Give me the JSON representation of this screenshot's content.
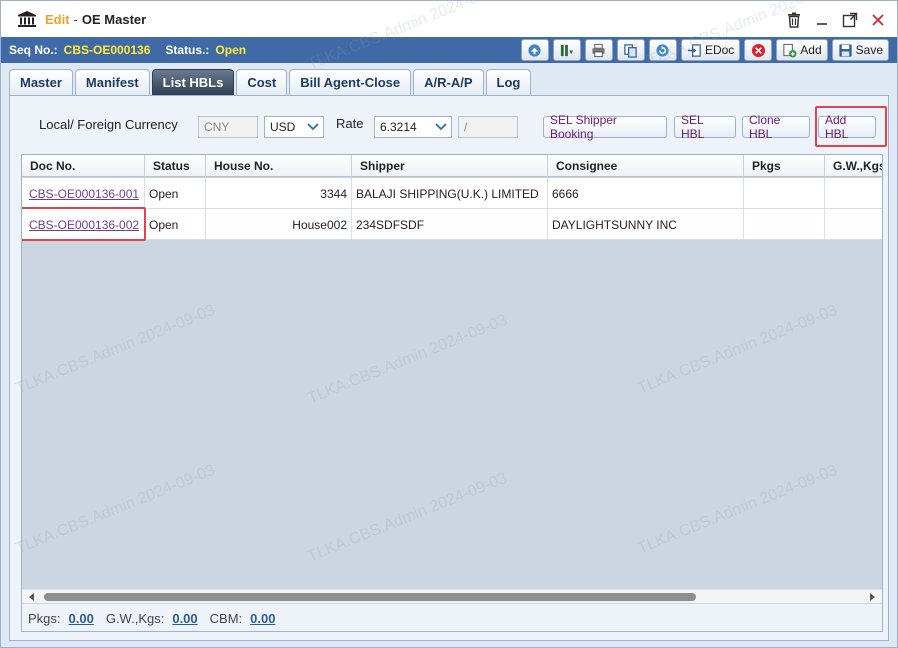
{
  "window": {
    "edit_label": "Edit",
    "separator": "-",
    "title": "OE Master"
  },
  "seqbar": {
    "seq_label": "Seq No.:",
    "seq_value": "CBS-OE000136",
    "status_label": "Status.:",
    "status_value": "Open"
  },
  "toolbar": {
    "edoc_label": "EDoc",
    "add_label": "Add",
    "save_label": "Save"
  },
  "tabs": [
    {
      "label": "Master"
    },
    {
      "label": "Manifest"
    },
    {
      "label": "List HBLs",
      "active": true
    },
    {
      "label": "Cost"
    },
    {
      "label": "Bill Agent-Close"
    },
    {
      "label": "A/R-A/P"
    },
    {
      "label": "Log"
    }
  ],
  "filters": {
    "currency_label": "Local/ Foreign Currency",
    "local_currency": "CNY",
    "foreign_currency": "USD",
    "rate_label": "Rate",
    "rate_value": "6.3214",
    "rate_extra": "/"
  },
  "actions": {
    "sel_shipper_booking": "SEL Shipper Booking",
    "sel_hbl": "SEL HBL",
    "clone_hbl": "Clone HBL",
    "add_hbl": "Add HBL"
  },
  "grid": {
    "columns": [
      "Doc No.",
      "Status",
      "House No.",
      "Shipper",
      "Consignee",
      "Pkgs",
      "G.W.,Kgs"
    ],
    "rows": [
      {
        "doc_no": "CBS-OE000136-001",
        "status": "Open",
        "house_no": "3344",
        "shipper": "BALAJI SHIPPING(U.K.) LIMITED",
        "consignee": "6666",
        "pkgs": "",
        "gw": ""
      },
      {
        "doc_no": "CBS-OE000136-002",
        "status": "Open",
        "house_no": "House002",
        "shipper": "234SDFSDF",
        "consignee": "DAYLIGHTSUNNY INC",
        "pkgs": "",
        "gw": ""
      }
    ]
  },
  "summary": {
    "pkgs_label": "Pkgs:",
    "pkgs_value": "0.00",
    "gw_label": "G.W.,Kgs:",
    "gw_value": "0.00",
    "cbm_label": "CBM:",
    "cbm_value": "0.00"
  },
  "watermark_text": "TLKA.CBS.Admin 2024-09-03",
  "colors": {
    "accent_blue": "#3f6aa5",
    "highlight_yellow": "#ffea3a",
    "edit_orange": "#f2a22c",
    "link_purple": "#6b3fa0",
    "callout_red": "#e0454f"
  }
}
